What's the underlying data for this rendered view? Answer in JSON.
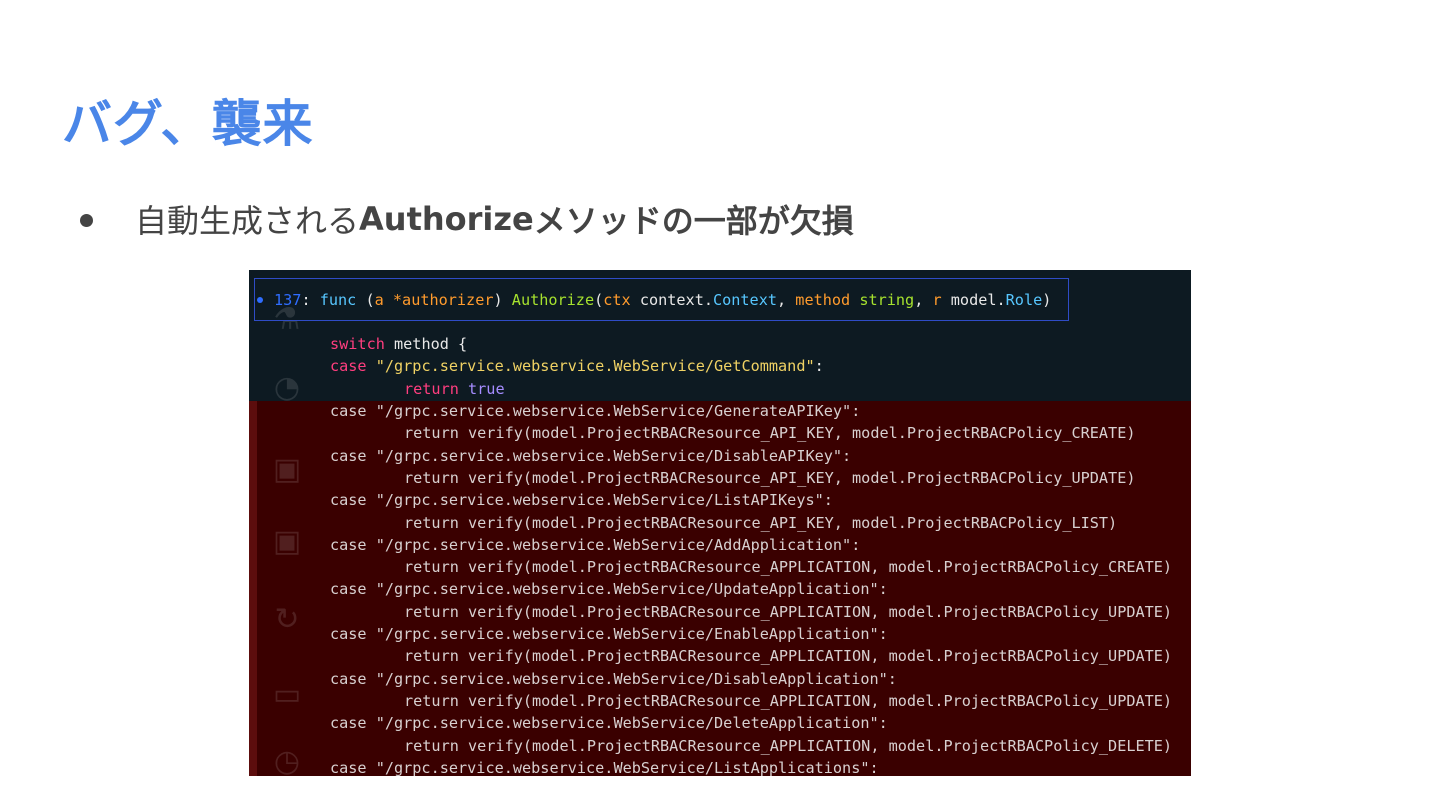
{
  "slide": {
    "title": "バグ、襲来",
    "bullet_prefix": "自動生成される",
    "bullet_bold": "Authorize",
    "bullet_suffix": "メソッドの一部が欠損"
  },
  "editor": {
    "line_number": "137",
    "signature": {
      "colon": ": ",
      "func_kw": "func",
      "open_paren": " (",
      "recv_name": "a",
      "recv_type": " *authorizer",
      "close_paren": ") ",
      "method_name": "Authorize",
      "args_open": "(",
      "arg1_name": "ctx",
      "arg1_pkg": " context.",
      "arg1_type": "Context",
      "comma1": ", ",
      "arg2_name": "method",
      "arg2_type": " string",
      "comma2": ", ",
      "arg3_name": "r",
      "arg3_pkg": " model.",
      "arg3_type": "Role",
      "args_close": ")"
    },
    "switch_kw": "switch",
    "switch_rest": " method {",
    "first_case_kw": "case",
    "first_case_str": " \"/grpc.service.webservice.WebService/GetCommand\"",
    "first_case_colon": ":",
    "return_kw": "return",
    "return_true": " true",
    "cases": [
      {
        "case": "case \"/grpc.service.webservice.WebService/GenerateAPIKey\":",
        "ret": "return verify(model.ProjectRBACResource_API_KEY, model.ProjectRBACPolicy_CREATE)"
      },
      {
        "case": "case \"/grpc.service.webservice.WebService/DisableAPIKey\":",
        "ret": "return verify(model.ProjectRBACResource_API_KEY, model.ProjectRBACPolicy_UPDATE)"
      },
      {
        "case": "case \"/grpc.service.webservice.WebService/ListAPIKeys\":",
        "ret": "return verify(model.ProjectRBACResource_API_KEY, model.ProjectRBACPolicy_LIST)"
      },
      {
        "case": "case \"/grpc.service.webservice.WebService/AddApplication\":",
        "ret": "return verify(model.ProjectRBACResource_APPLICATION, model.ProjectRBACPolicy_CREATE)"
      },
      {
        "case": "case \"/grpc.service.webservice.WebService/UpdateApplication\":",
        "ret": "return verify(model.ProjectRBACResource_APPLICATION, model.ProjectRBACPolicy_UPDATE)"
      },
      {
        "case": "case \"/grpc.service.webservice.WebService/EnableApplication\":",
        "ret": "return verify(model.ProjectRBACResource_APPLICATION, model.ProjectRBACPolicy_UPDATE)"
      },
      {
        "case": "case \"/grpc.service.webservice.WebService/DisableApplication\":",
        "ret": "return verify(model.ProjectRBACResource_APPLICATION, model.ProjectRBACPolicy_UPDATE)"
      },
      {
        "case": "case \"/grpc.service.webservice.WebService/DeleteApplication\":",
        "ret": "return verify(model.ProjectRBACResource_APPLICATION, model.ProjectRBACPolicy_DELETE)"
      },
      {
        "case": "case \"/grpc.service.webservice.WebService/ListApplications\":",
        "ret": ""
      }
    ]
  }
}
